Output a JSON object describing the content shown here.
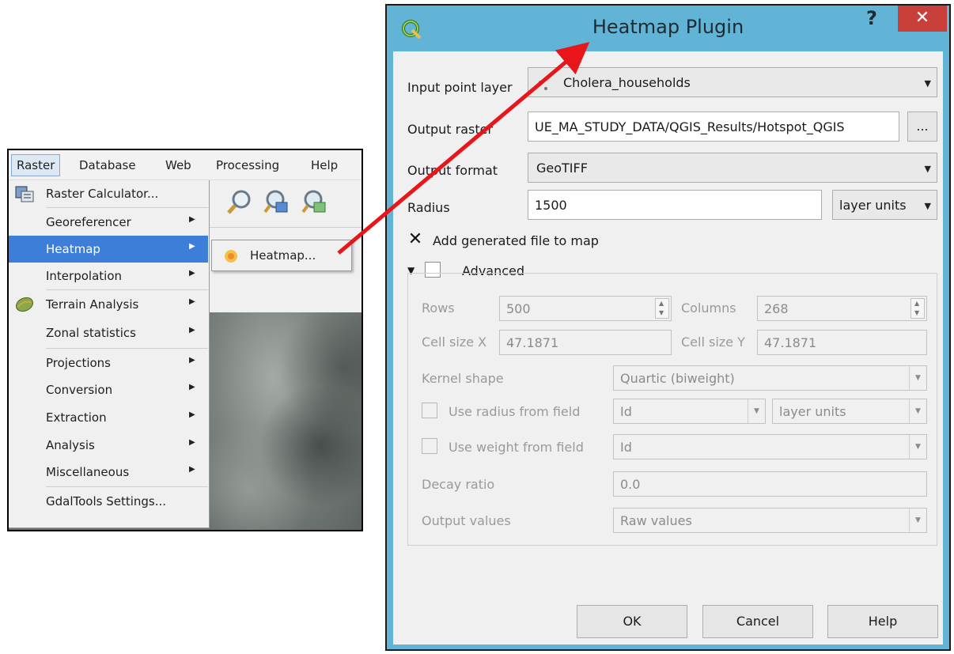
{
  "menubar": {
    "items": [
      "Raster",
      "Database",
      "Web",
      "Processing",
      "Help"
    ]
  },
  "raster_menu": {
    "items": [
      {
        "label": "Raster Calculator...",
        "icon": "raster-calculator-icon"
      },
      {
        "label": "Georeferencer",
        "submenu": true
      },
      {
        "label": "Heatmap",
        "submenu": true,
        "highlighted": true
      },
      {
        "label": "Interpolation",
        "submenu": true
      },
      {
        "label": "Terrain Analysis",
        "submenu": true,
        "icon": "terrain-analysis-icon"
      },
      {
        "label": "Zonal statistics",
        "submenu": true
      },
      {
        "label": "Projections",
        "submenu": true
      },
      {
        "label": "Conversion",
        "submenu": true
      },
      {
        "label": "Extraction",
        "submenu": true
      },
      {
        "label": "Analysis",
        "submenu": true
      },
      {
        "label": "Miscellaneous",
        "submenu": true
      },
      {
        "label": "GdalTools Settings..."
      }
    ],
    "highlight_color": "#3d7ed8"
  },
  "heatmap_submenu": {
    "item": "Heatmap..."
  },
  "dialog": {
    "title": "Heatmap Plugin",
    "help_glyph": "?",
    "close_glyph": "✕",
    "titlebar_color": "#62b4d6",
    "close_color": "#c9403a",
    "input_point_layer": {
      "label": "Input point layer",
      "value": "Cholera_households"
    },
    "output_raster": {
      "label": "Output raster",
      "value": "UE_MA_STUDY_DATA/QGIS_Results/Hotspot_QGIS",
      "browse": "..."
    },
    "output_format": {
      "label": "Output format",
      "value": "GeoTIFF"
    },
    "radius": {
      "label": "Radius",
      "value": "1500",
      "units": "layer units"
    },
    "add_to_map": {
      "label": "Add generated file to map",
      "checked": true
    },
    "advanced": {
      "label": "Advanced",
      "checked": false,
      "rows": {
        "label": "Rows",
        "value": "500"
      },
      "columns": {
        "label": "Columns",
        "value": "268"
      },
      "cell_size_x": {
        "label": "Cell size X",
        "value": "47.1871"
      },
      "cell_size_y": {
        "label": "Cell size Y",
        "value": "47.1871"
      },
      "kernel_shape": {
        "label": "Kernel shape",
        "value": "Quartic (biweight)"
      },
      "use_radius_from_field": {
        "label": "Use radius from field",
        "field": "Id",
        "units": "layer units"
      },
      "use_weight_from_field": {
        "label": "Use weight from field",
        "field": "Id"
      },
      "decay_ratio": {
        "label": "Decay ratio",
        "value": "0.0"
      },
      "output_values": {
        "label": "Output values",
        "value": "Raw values"
      }
    },
    "buttons": {
      "ok": "OK",
      "cancel": "Cancel",
      "help": "Help"
    }
  },
  "annotation": {
    "arrow_color": "#e8161a"
  }
}
